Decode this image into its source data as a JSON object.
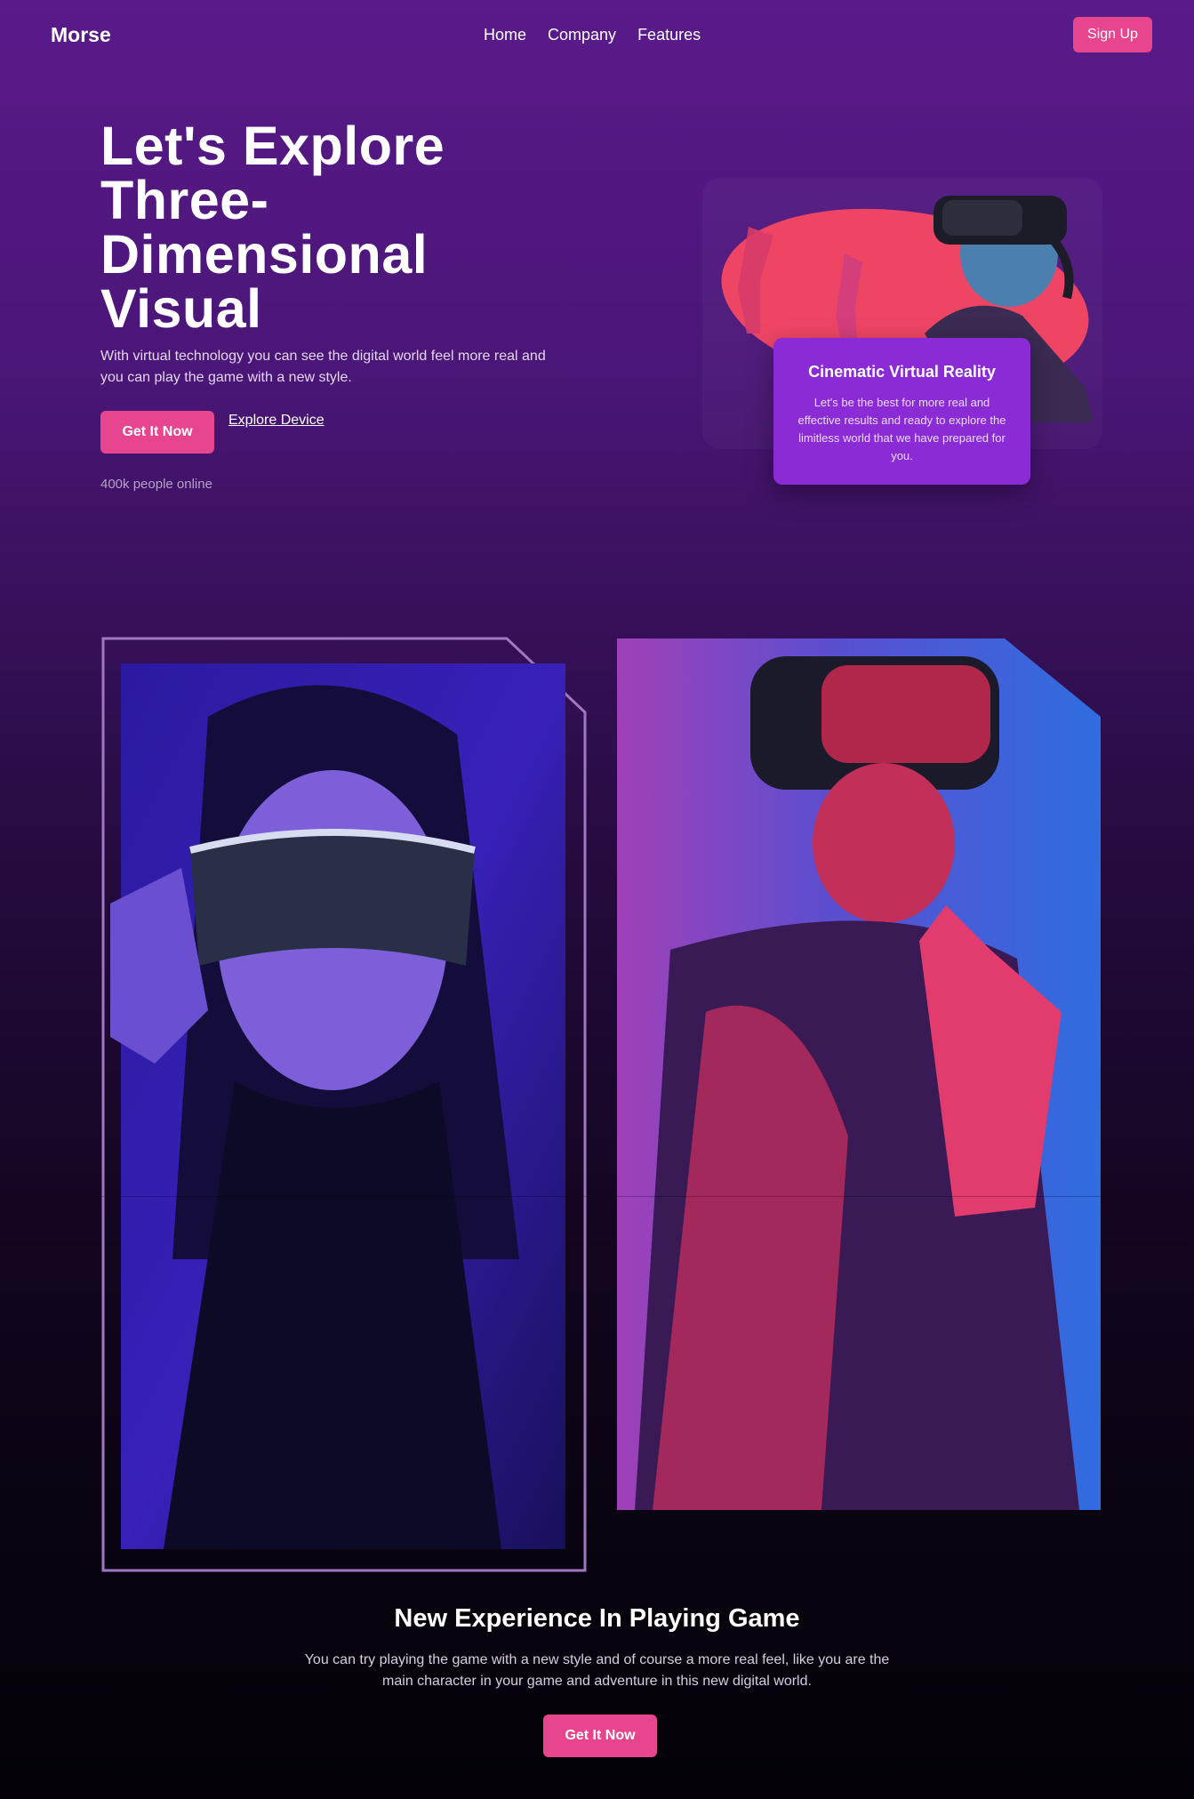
{
  "nav": {
    "logo": "Morse",
    "links": [
      "Home",
      "Company",
      "Features"
    ],
    "signup": "Sign Up"
  },
  "hero": {
    "title": "Let's Explore Three-Dimensional Visual",
    "subtitle": "With virtual technology you can see the digital world feel more real and you can play the game with a new style.",
    "primary_button": "Get It Now",
    "secondary_link": "Explore Device",
    "online": "400k people online"
  },
  "feature_card": {
    "title": "Cinematic Virtual Reality",
    "text": "Let's be the best for more real and effective results and ready to explore the limitless world that we have prepared for you."
  },
  "section": {
    "title": "New Experience In Playing Game",
    "text": "You can try playing the game with a new style and of course a more real feel, like you are the main character in your game and adventure in this new digital world.",
    "button": "Get It Now"
  },
  "colors": {
    "accent": "#e8458f",
    "card": "#8a2bd6",
    "blob": "#ef4565"
  }
}
